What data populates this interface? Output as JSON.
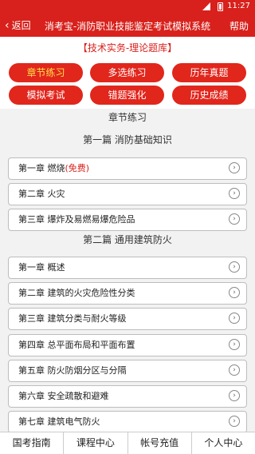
{
  "status": {
    "time": "11:27"
  },
  "nav": {
    "back": "返回",
    "title": "消考宝-消防职业技能鉴定考试模拟系统",
    "help": "帮助"
  },
  "subhead": "【技术实务-理论题库】",
  "tabs": [
    "章节练习",
    "多选练习",
    "历年真题",
    "模拟考试",
    "错题强化",
    "历史成绩"
  ],
  "section_title": "章节练习",
  "parts": [
    {
      "title": "第一篇 消防基础知识",
      "chapters": [
        "第一章 燃烧",
        "第二章 火灾",
        "第三章 爆炸及易燃易爆危险品"
      ],
      "free_tag": "(免费)"
    },
    {
      "title": "第二篇 通用建筑防火",
      "chapters": [
        "第一章 概述",
        "第二章 建筑的火灾危险性分类",
        "第三章 建筑分类与耐火等级",
        "第四章 总平面布局和平面布置",
        "第五章 防火防烟分区与分隔",
        "第六章 安全疏散和避难",
        "第七章 建筑电气防火"
      ]
    }
  ],
  "bottom_nav": [
    "国考指南",
    "课程中心",
    "帐号充值",
    "个人中心"
  ],
  "colors": {
    "primary": "#d8211c",
    "active_tab_text": "#ffe24a"
  }
}
